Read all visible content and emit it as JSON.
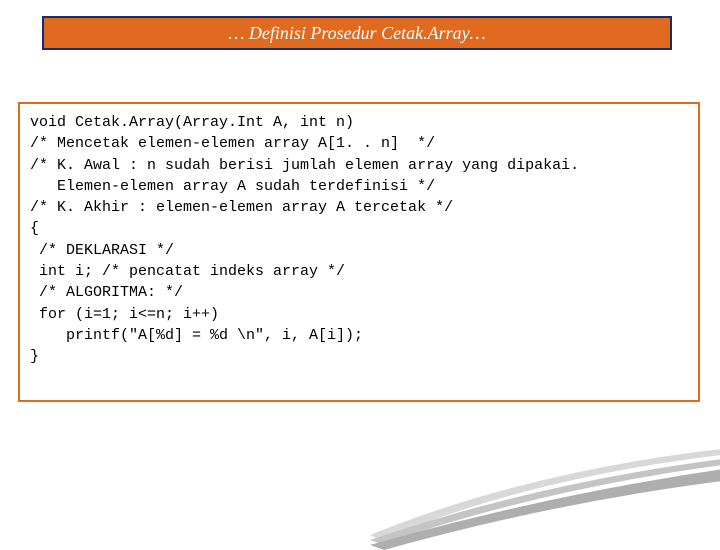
{
  "title": "… Definisi Prosedur Cetak.Array…",
  "code": {
    "l1": "void Cetak.Array(Array.Int A, int n)",
    "l2": "/* Mencetak elemen-elemen array A[1. . n]  */",
    "l3": "/* K. Awal : n sudah berisi jumlah elemen array yang dipakai.",
    "l4": "   Elemen-elemen array A sudah terdefinisi */",
    "l5": "/* K. Akhir : elemen-elemen array A tercetak */",
    "l6": "{",
    "l7": " /* DEKLARASI */",
    "l8": " int i; /* pencatat indeks array */",
    "l9": " /* ALGORITMA: */",
    "l10": " for (i=1; i<=n; i++)",
    "l11": "    printf(\"A[%d] = %d \\n\", i, A[i]);",
    "l12": "}"
  }
}
